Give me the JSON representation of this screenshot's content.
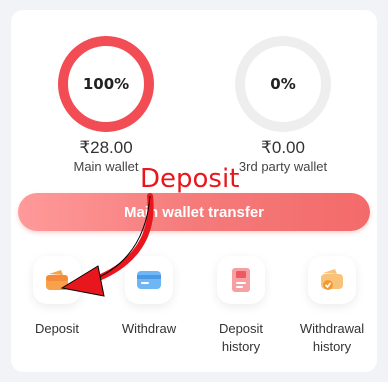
{
  "wallets": {
    "main": {
      "percent": "100%",
      "amount": "₹28.00",
      "label": "Main wallet",
      "fill": 1.0,
      "color": "#f24d54"
    },
    "third_party": {
      "percent": "0%",
      "amount": "₹0.00",
      "label": "3rd party wallet",
      "fill": 0.0,
      "color": "#eeeeee"
    }
  },
  "transfer_button": {
    "label": "Main wallet transfer"
  },
  "actions": [
    {
      "label_line1": "Deposit",
      "label_line2": "",
      "icon": "wallet-icon"
    },
    {
      "label_line1": "Withdraw",
      "label_line2": "",
      "icon": "card-icon"
    },
    {
      "label_line1": "Deposit",
      "label_line2": "history",
      "icon": "receipt-icon"
    },
    {
      "label_line1": "Withdrawal",
      "label_line2": "history",
      "icon": "wallet-history-icon"
    }
  ],
  "annotation": {
    "text": "Deposit",
    "color": "#e8171e"
  }
}
